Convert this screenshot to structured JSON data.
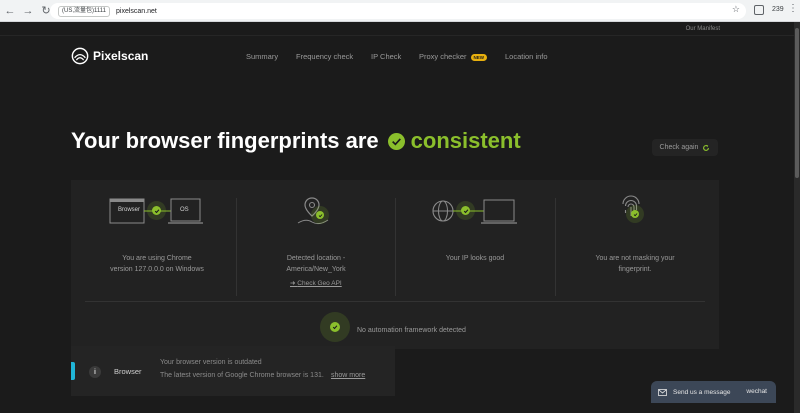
{
  "browser": {
    "tab_chip": "(US,流量包)1111",
    "url": "pixelscan.net",
    "count": "239"
  },
  "page": {
    "top_link": "Our Manifest",
    "logo_text": "Pixelscan",
    "nav": [
      {
        "label": "Summary"
      },
      {
        "label": "Frequency check"
      },
      {
        "label": "IP Check"
      },
      {
        "label": "Proxy checker",
        "badge": "NEW"
      },
      {
        "label": "Location info"
      }
    ],
    "headline": {
      "text": "Your browser fingerprints are",
      "status": "consistent"
    },
    "check_again": "Check again",
    "cells": {
      "browser_box": "Browser",
      "os_box": "OS",
      "browser_text": [
        "You are using Chrome",
        "version 127.0.0.0 on Windows"
      ],
      "location_text": [
        "Detected location -",
        "America/New_York"
      ],
      "geo_link": "Check Geo API",
      "ip_text": "Your IP looks good",
      "mask_text": [
        "You are not masking your",
        "fingerprint."
      ]
    },
    "automation": "No automation framework detected",
    "warning": {
      "label": "Browser",
      "title": "Your browser version is outdated",
      "subtitle": "The latest version of Google Chrome browser is 131.",
      "link": "show more"
    },
    "chat": {
      "text": "Send us a message",
      "brand": "wechat"
    }
  },
  "colors": {
    "accent": "#8bbf2c",
    "background": "#1b1b1b",
    "card": "#222222",
    "badge": "#e8b00e",
    "edge": "#20b5d7"
  }
}
